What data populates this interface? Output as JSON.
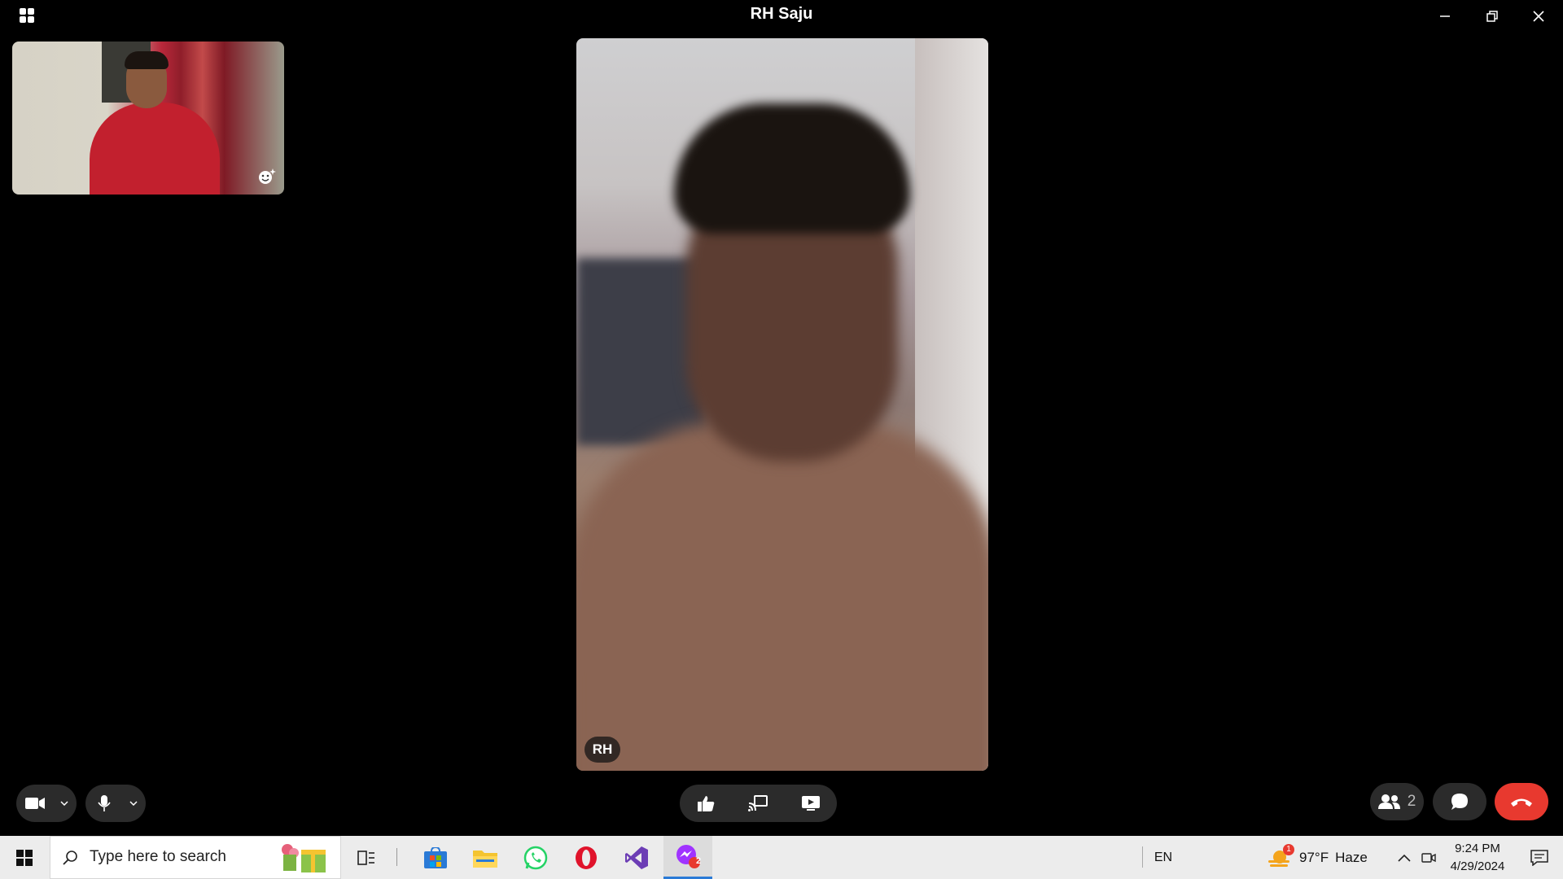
{
  "window": {
    "title": "RH Saju"
  },
  "call": {
    "remote_initials": "RH",
    "participants_count": "2"
  },
  "taskbar": {
    "search_placeholder": "Type here to search",
    "language": "EN",
    "weather_temp": "97°F",
    "weather_desc": "Haze",
    "weather_badge": "1",
    "messenger_badge": "2",
    "time": "9:24 PM",
    "date": "4/29/2024"
  },
  "colors": {
    "end_call": "#e8392f",
    "pill_bg": "#2b2b2b",
    "taskbar_bg": "#ececec"
  }
}
